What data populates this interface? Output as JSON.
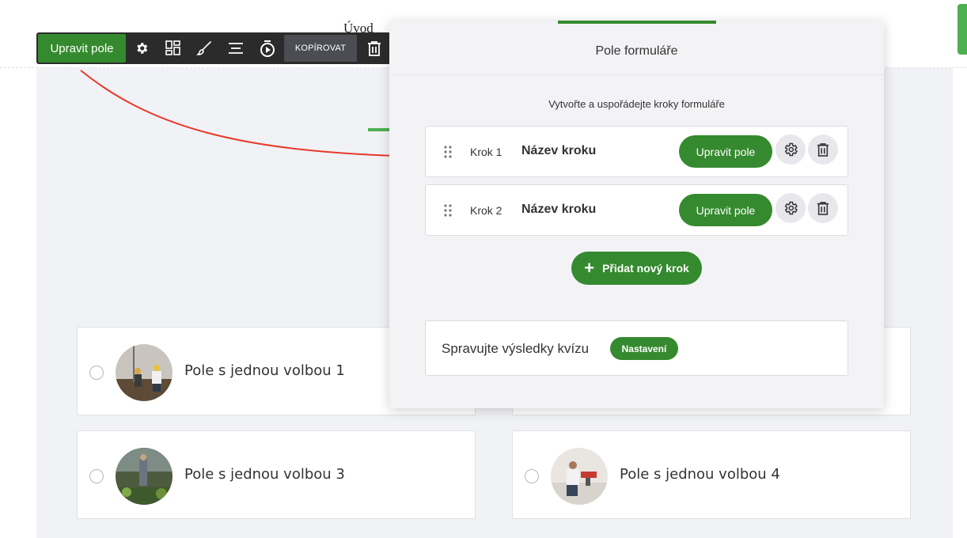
{
  "page": {
    "heading": "Úvod",
    "choices": [
      {
        "label": "Pole s jednou volbou 1",
        "image": "construction-workers-photo"
      },
      {
        "label": "Pole s jednou volbou 3",
        "image": "gardener-photo"
      },
      {
        "label": "Pole s jednou volbou 4",
        "image": "carpenter-photo"
      }
    ]
  },
  "toolbar": {
    "edit_label": "Upravit pole",
    "copy_label": "KOPÍROVAT",
    "icons": [
      "gear-icon",
      "layout-icon",
      "brush-icon",
      "align-icon",
      "timer-icon",
      "trash-icon"
    ]
  },
  "modal": {
    "title": "Pole formuláře",
    "subtitle": "Vytvořte a uspořádejte kroky formuláře",
    "steps": [
      {
        "number": "Krok 1",
        "name": "Název kroku",
        "edit_label": "Upravit pole"
      },
      {
        "number": "Krok 2",
        "name": "Název kroku",
        "edit_label": "Upravit pole"
      }
    ],
    "add_step_label": "Přidat nový krok",
    "quiz": {
      "label": "Spravujte výsledky kvízu",
      "badge": "Nastavení"
    }
  },
  "colors": {
    "accent": "#358a2f",
    "arrow": "#e8392a",
    "toolbar": "#2b2b2b"
  }
}
